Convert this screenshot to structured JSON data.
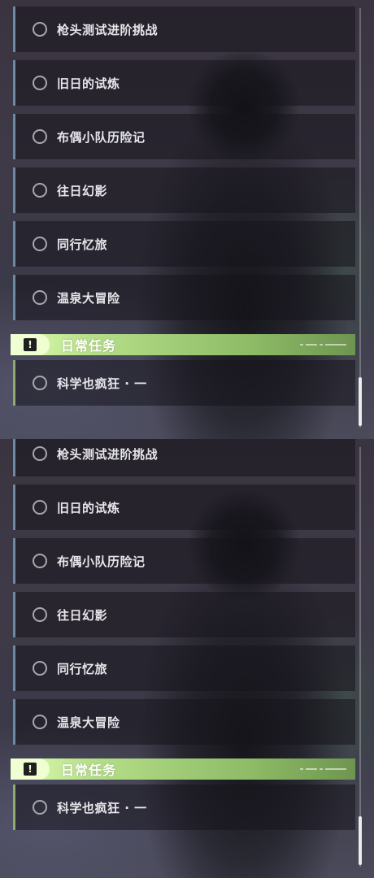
{
  "quests": [
    {
      "label": "枪头测试进阶挑战"
    },
    {
      "label": "旧日的试炼"
    },
    {
      "label": "布偶小队历险记"
    },
    {
      "label": "往日幻影"
    },
    {
      "label": "同行忆旅"
    },
    {
      "label": "温泉大冒险"
    }
  ],
  "daily_section": {
    "title": "日常任务",
    "icon": "exclamation-icon",
    "items": [
      {
        "label": "科学也疯狂 · 一"
      }
    ]
  },
  "colors": {
    "quest_accent": "#6a8aa6",
    "daily_accent": "#8cab6c",
    "section_header": "#b8e08a"
  }
}
